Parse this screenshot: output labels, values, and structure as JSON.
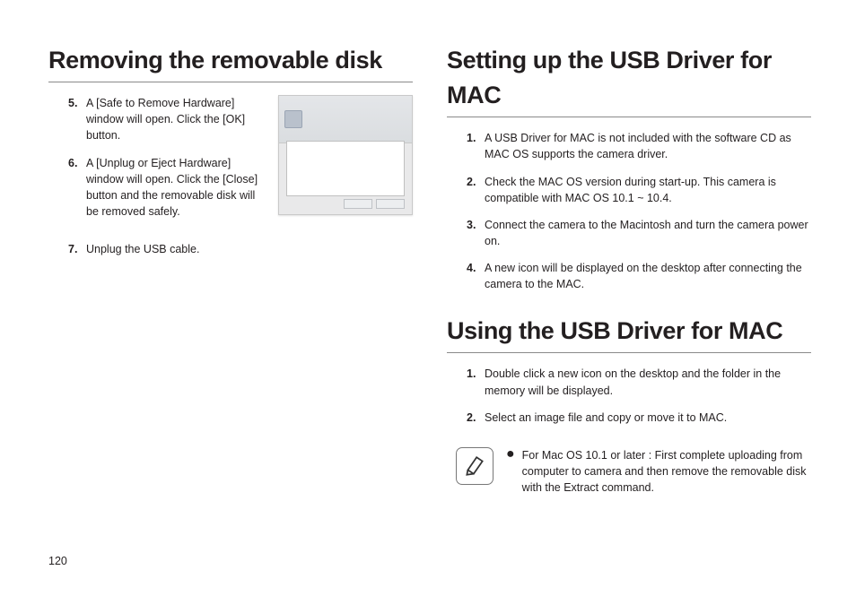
{
  "page_number": "120",
  "left": {
    "heading": "Removing the removable disk",
    "steps": [
      {
        "num": "5.",
        "text": "A [Safe to Remove Hardware] window will open. Click the [OK] button."
      },
      {
        "num": "6.",
        "text": "A [Unplug or Eject Hardware] window will open. Click the [Close] button and the removable disk will be removed safely."
      },
      {
        "num": "7.",
        "text": "Unplug the USB cable."
      }
    ]
  },
  "right": {
    "setup": {
      "heading": "Setting up the USB Driver for MAC",
      "steps": [
        {
          "num": "1.",
          "text": "A USB Driver for MAC is not included with the software CD as MAC OS supports the camera driver."
        },
        {
          "num": "2.",
          "text": "Check the MAC OS version during start-up. This camera is compatible with MAC OS 10.1 ~ 10.4."
        },
        {
          "num": "3.",
          "text": "Connect the camera to the Macintosh and turn the camera power on."
        },
        {
          "num": "4.",
          "text": "A new icon will be displayed on the desktop after connecting the camera to the MAC."
        }
      ]
    },
    "using": {
      "heading": "Using the USB Driver for MAC",
      "steps": [
        {
          "num": "1.",
          "text": "Double click a new icon on the desktop and the folder in the memory will be displayed."
        },
        {
          "num": "2.",
          "text": "Select an image file and copy or move it to MAC."
        }
      ]
    },
    "note": "For Mac OS 10.1 or later : First complete uploading from computer to camera and then remove the removable disk with the Extract command."
  }
}
